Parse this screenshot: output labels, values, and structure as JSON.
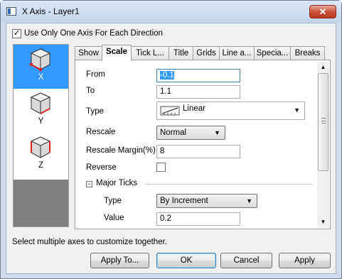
{
  "window": {
    "title": "X Axis - Layer1",
    "close_glyph": "✕"
  },
  "options": {
    "one_axis_label": "Use Only One Axis For Each Direction",
    "one_axis_checked": true
  },
  "axes": [
    {
      "label": "X",
      "selected": true,
      "icon": "x-axis-icon"
    },
    {
      "label": "Y",
      "selected": false,
      "icon": "y-axis-icon"
    },
    {
      "label": "Z",
      "selected": false,
      "icon": "z-axis-icon"
    }
  ],
  "tabs": [
    "Show",
    "Scale",
    "Tick L...",
    "Title",
    "Grids",
    "Line a...",
    "Specia...",
    "Breaks"
  ],
  "active_tab": "Scale",
  "scale": {
    "from_label": "From",
    "from_value": "-0.1",
    "to_label": "To",
    "to_value": "1.1",
    "type_label": "Type",
    "type_value": "Linear",
    "rescale_label": "Rescale",
    "rescale_value": "Normal",
    "rescale_margin_label": "Rescale Margin(%)",
    "rescale_margin_value": "8",
    "reverse_label": "Reverse",
    "reverse_checked": false,
    "major_ticks": {
      "section_label": "Major Ticks",
      "expand_glyph": "−",
      "type_label": "Type",
      "type_value": "By Increment",
      "value_label": "Value",
      "value_value": "0.2"
    }
  },
  "status_text": "Select multiple axes to customize together.",
  "buttons": {
    "apply_to": "Apply To...",
    "ok": "OK",
    "cancel": "Cancel",
    "apply": "Apply"
  },
  "glyphs": {
    "dropdown": "▼",
    "scroll_up": "▲",
    "scroll_down": "▼"
  }
}
